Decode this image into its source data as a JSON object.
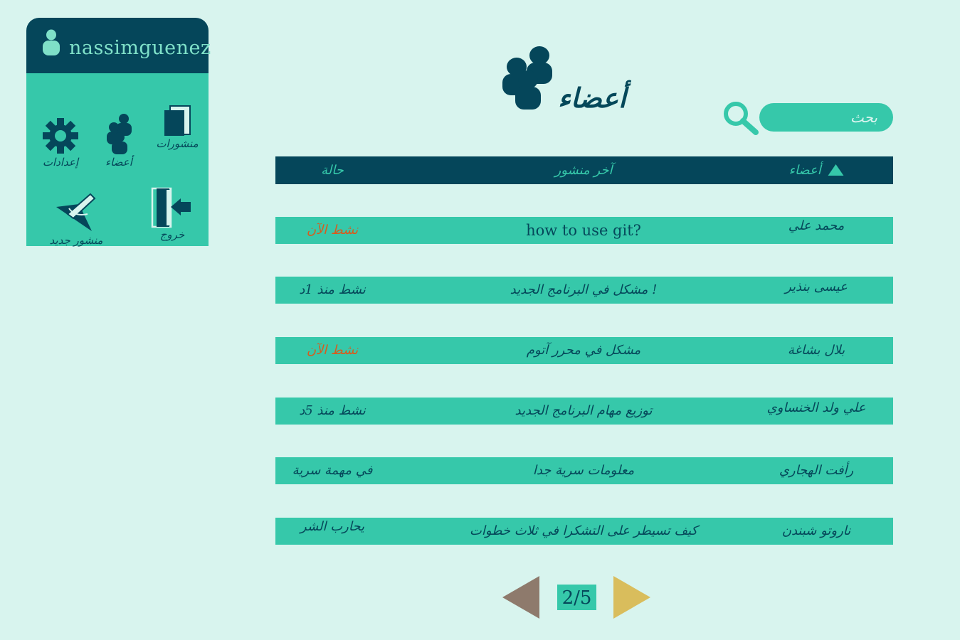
{
  "user": {
    "username": "nassimguenez"
  },
  "panel": {
    "items": [
      {
        "id": "posts",
        "label": "منشورات",
        "icon": "pages-icon"
      },
      {
        "id": "members",
        "label": "أعضاء",
        "icon": "members-icon"
      },
      {
        "id": "settings",
        "label": "إعدادات",
        "icon": "gear-icon"
      },
      {
        "id": "logout",
        "label": "خروج",
        "icon": "logout-icon"
      },
      {
        "id": "new_post",
        "label": "منشور جديد",
        "icon": "pen-icon"
      }
    ]
  },
  "page": {
    "title": "أعضاء",
    "title_icon": "members-icon"
  },
  "search": {
    "placeholder": "بحث",
    "icon": "search-icon"
  },
  "table": {
    "headers": {
      "member": "أعضاء",
      "last_post": "آخر منشور",
      "status": "حالة"
    },
    "sort_icon": "sort-up-triangle-icon",
    "rows": [
      {
        "member": "محمد علي",
        "last_post": "how to use git?",
        "status": "نشط الآن",
        "active": true
      },
      {
        "member": "عيسى بنذير",
        "last_post": "مشكل في البرنامج الجديد !",
        "status": "نشط منذ 1د",
        "active": false
      },
      {
        "member": "بلال بشاغة",
        "last_post": "مشكل في محرر آتوم",
        "status": "نشط الآن",
        "active": true
      },
      {
        "member": "علي ولد الخنساوي",
        "last_post": "توزيع مهام البرنامج الجديد",
        "status": "نشط منذ 5د",
        "active": false
      },
      {
        "member": "رأفت الهجاري",
        "last_post": "معلومات سرية جدا",
        "status": "في مهمة سرية",
        "active": false
      },
      {
        "member": "ناروتو شبندن",
        "last_post": "كيف تسيطر على التشكرا في ثلاث خطوات",
        "status": "يحارب الشر",
        "active": false
      }
    ]
  },
  "pagination": {
    "current": 2,
    "total": 5,
    "label": "2/5"
  },
  "colors": {
    "background": "#d8f4ee",
    "dark": "#05465a",
    "accent": "#36c8aa",
    "active_status": "#d85b1c",
    "prev_arrow": "#8e7a6c",
    "next_arrow": "#d9bd5c"
  }
}
